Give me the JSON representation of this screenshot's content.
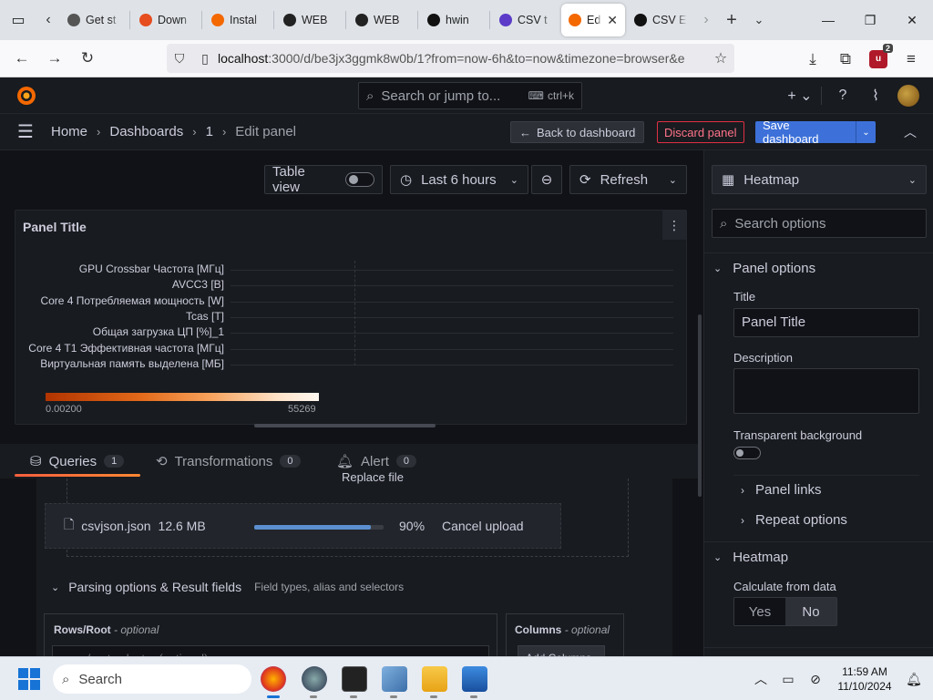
{
  "browser": {
    "tabs": [
      {
        "label": "Get st",
        "color": "#555"
      },
      {
        "label": "Down",
        "color": "#e64d1f"
      },
      {
        "label": "Instal",
        "color": "#f46800"
      },
      {
        "label": "WEB",
        "color": "#222"
      },
      {
        "label": "WEB",
        "color": "#222"
      },
      {
        "label": "hwin",
        "color": "#111"
      },
      {
        "label": "CSV t",
        "color": "#5b3bc8"
      },
      {
        "label": "Edi",
        "color": "#f46800"
      },
      {
        "label": "CSV E",
        "color": "#111"
      }
    ],
    "active_tab_index": 7,
    "url_host": "localhost",
    "url_rest": ":3000/d/be3jx3ggmk8w0b/1?from=now-6h&to=now&timezone=browser&e",
    "extension_badge": "2"
  },
  "grafana": {
    "search_placeholder": "Search or jump to...",
    "search_shortcut": "ctrl+k",
    "breadcrumbs": [
      "Home",
      "Dashboards",
      "1",
      "Edit panel"
    ],
    "back_button": "Back to dashboard",
    "discard_button": "Discard panel",
    "save_button": "Save dashboard",
    "toolbar": {
      "table_view": "Table view",
      "time_range": "Last 6 hours",
      "refresh": "Refresh"
    },
    "panel": {
      "title": "Panel Title",
      "series": [
        "GPU Crossbar Частота [МГц]",
        "AVCC3 [B]",
        "Core 4 Потребляемая мощность [W]",
        "Tcas [T]",
        "Общая загрузка ЦП [%]_1",
        "Core 4 T1 Эффективная частота [МГц]",
        "Виртуальная память выделена [МБ]"
      ],
      "legend_min": "0.00200",
      "legend_max": "55269"
    },
    "query_tabs": [
      {
        "label": "Queries",
        "count": "1"
      },
      {
        "label": "Transformations",
        "count": "0"
      },
      {
        "label": "Alert",
        "count": "0"
      }
    ],
    "upload": {
      "replace_file": "Replace file",
      "file_name": "csvjson.json",
      "file_size": "12.6 MB",
      "progress_percent": 90,
      "progress_label": "90%",
      "cancel": "Cancel upload"
    },
    "parsing": {
      "title": "Parsing options & Result fields",
      "description": "Field types, alias and selectors",
      "rows_label": "Rows/Root",
      "rows_optional": "- optional",
      "rows_placeholder": "rows/root selector (optional)",
      "columns_label": "Columns",
      "columns_optional": "- optional",
      "add_columns": "Add Columns"
    },
    "options": {
      "visualization": "Heatmap",
      "search_placeholder": "Search options",
      "panel_options": "Panel options",
      "title_label": "Title",
      "title_value": "Panel Title",
      "description_label": "Description",
      "transparent_label": "Transparent background",
      "panel_links": "Panel links",
      "repeat_options": "Repeat options",
      "heatmap_section": "Heatmap",
      "calculate_label": "Calculate from data",
      "yes": "Yes",
      "no": "No"
    }
  },
  "taskbar": {
    "search": "Search",
    "time": "11:59 AM",
    "date": "11/10/2024"
  }
}
